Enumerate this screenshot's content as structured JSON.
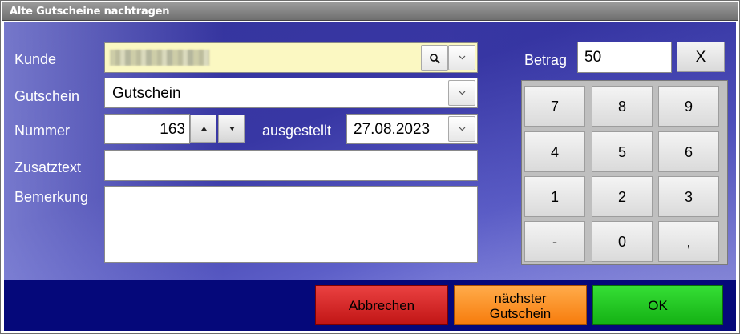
{
  "window": {
    "title": "Alte Gutscheine nachtragen"
  },
  "form": {
    "kunde_label": "Kunde",
    "gutschein_label": "Gutschein",
    "gutschein_value": "Gutschein",
    "nummer_label": "Nummer",
    "nummer_value": "163",
    "ausgestellt_label": "ausgestellt",
    "ausgestellt_value": "27.08.2023",
    "zusatztext_label": "Zusatztext",
    "zusatztext_value": "",
    "bemerkung_label": "Bemerkung",
    "bemerkung_value": ""
  },
  "betrag": {
    "label": "Betrag",
    "value": "50",
    "clear_label": "X"
  },
  "keypad": [
    "7",
    "8",
    "9",
    "4",
    "5",
    "6",
    "1",
    "2",
    "3",
    "-",
    "0",
    ","
  ],
  "footer": {
    "cancel_label": "Abbrechen",
    "next_label_1": "nächster",
    "next_label_2": "Gutschein",
    "ok_label": "OK"
  },
  "colors": {
    "cancel": "#d92a2a",
    "next": "#ff8d1e",
    "ok": "#22c422",
    "customer_field": "#fbf8c2"
  }
}
